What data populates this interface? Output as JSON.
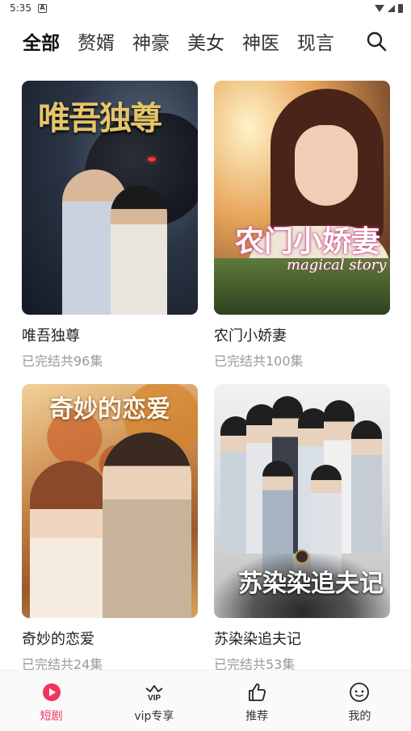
{
  "status_bar": {
    "time": "5:35",
    "sim_label": "A"
  },
  "tabs": [
    {
      "label": "全部",
      "active": true
    },
    {
      "label": "赘婿",
      "active": false
    },
    {
      "label": "神豪",
      "active": false
    },
    {
      "label": "美女",
      "active": false
    },
    {
      "label": "神医",
      "active": false
    },
    {
      "label": "现言",
      "active": false
    }
  ],
  "search_icon": "search-icon",
  "dramas": [
    {
      "title": "唯吾独尊",
      "status": "已完结共96集",
      "poster_text": "唯吾独尊"
    },
    {
      "title": "农门小娇妻",
      "status": "已完结共100集",
      "poster_text": "农门小娇妻",
      "poster_subtitle": "magical story"
    },
    {
      "title": "奇妙的恋爱",
      "status": "已完结共24集",
      "poster_text": "奇妙的恋爱"
    },
    {
      "title": "苏染染追夫记",
      "status": "已完结共53集",
      "poster_text": "苏染染追夫记"
    }
  ],
  "bottom_nav": [
    {
      "label": "短剧",
      "icon": "play-circle-icon",
      "active": true
    },
    {
      "label": "vip专享",
      "icon": "vip-crown-icon",
      "active": false
    },
    {
      "label": "推荐",
      "icon": "thumbs-up-icon",
      "active": false
    },
    {
      "label": "我的",
      "icon": "smile-face-icon",
      "active": false
    }
  ],
  "colors": {
    "accent": "#f0355f",
    "muted_text": "#999999"
  }
}
